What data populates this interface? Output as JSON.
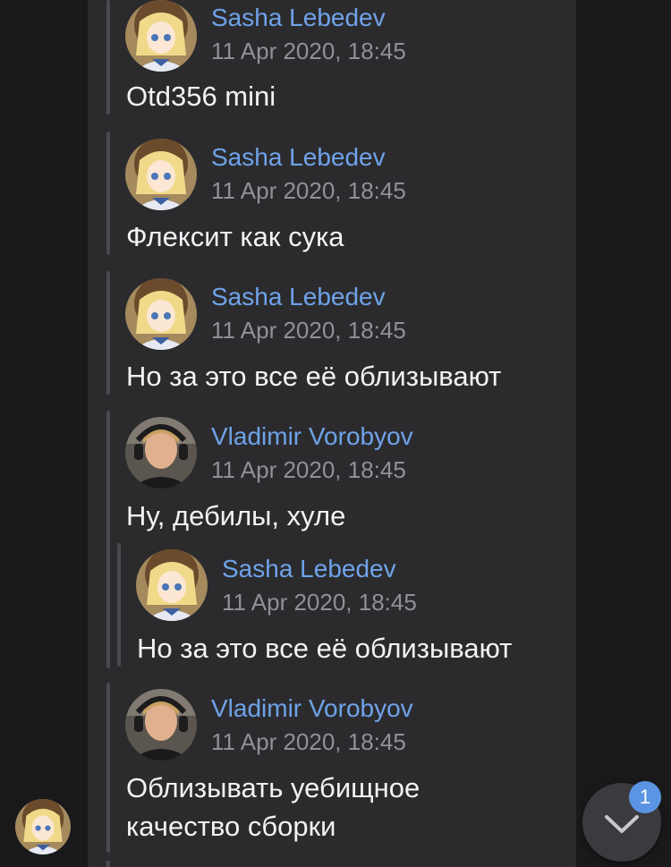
{
  "messages": [
    {
      "author": "Sasha Lebedev",
      "time": "11 Apr 2020, 18:45",
      "text": "Otd356 mini",
      "avatar": "anime-girl-avatar"
    },
    {
      "author": "Sasha Lebedev",
      "time": "11 Apr 2020, 18:45",
      "text": "Флексит как сука",
      "avatar": "anime-girl-avatar"
    },
    {
      "author": "Sasha Lebedev",
      "time": "11 Apr 2020, 18:45",
      "text": "Но за это все её облизывают",
      "avatar": "anime-girl-avatar"
    },
    {
      "author": "Vladimir Vorobyov",
      "time": "11 Apr 2020, 18:45",
      "text": "Ну, дебилы, хуле",
      "avatar": "man-with-headphones-avatar",
      "quote": {
        "author": "Sasha Lebedev",
        "time": "11 Apr 2020, 18:45",
        "text": "Но за это все её облизывают",
        "avatar": "anime-girl-avatar"
      }
    },
    {
      "author": "Vladimir Vorobyov",
      "time": "11 Apr 2020, 18:45",
      "text_lines": [
        "Облизывать уебищное",
        "качество сборки"
      ],
      "avatar": "man-with-headphones-avatar"
    }
  ],
  "scroll_down": {
    "badge_count": "1",
    "icon": "chevron-down-icon"
  },
  "colors": {
    "background": "#19191b",
    "bubble": "#2b2b2e",
    "author": "#6fa3e9",
    "time": "#909096",
    "text": "#f2f2f4",
    "badge": "#5b94e2"
  }
}
